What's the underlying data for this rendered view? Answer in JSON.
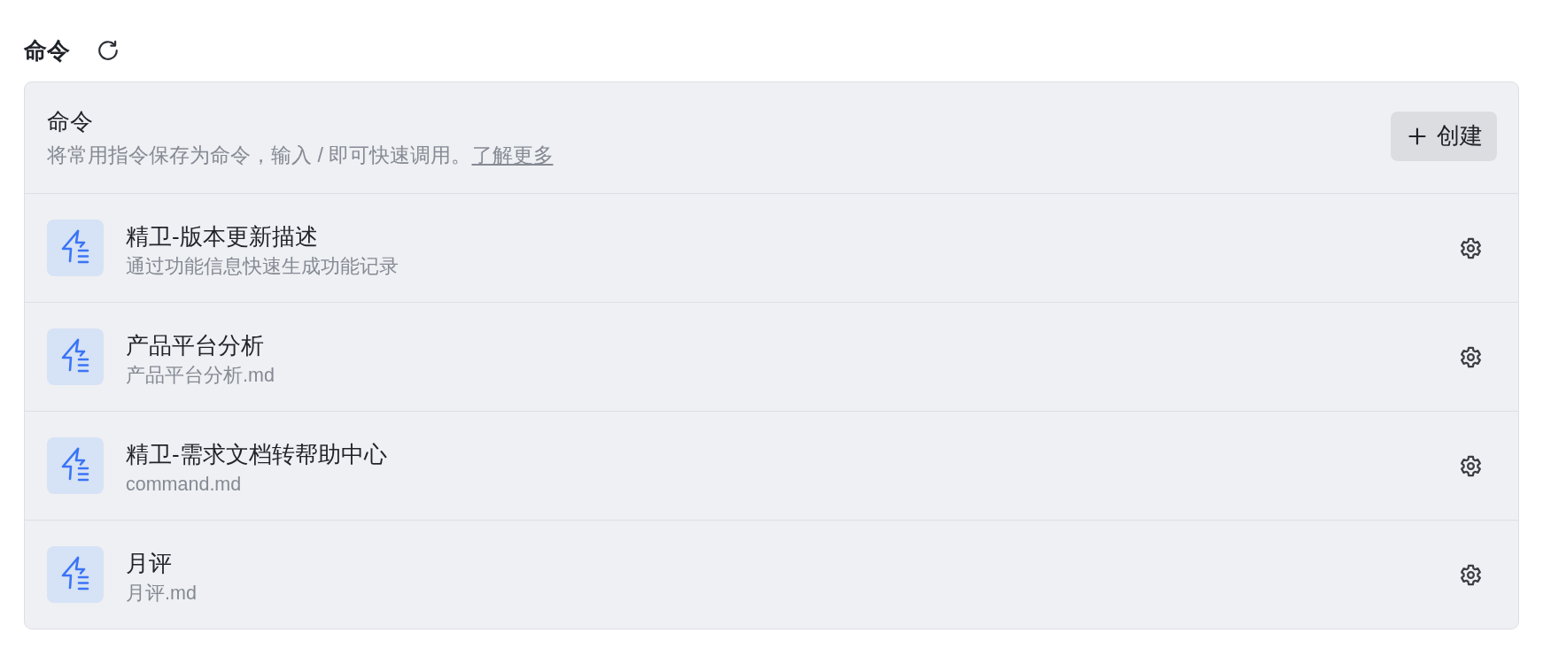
{
  "page": {
    "title": "命令"
  },
  "header": {
    "title": "命令",
    "description": "将常用指令保存为命令，输入 / 即可快速调用。",
    "link": "了解更多",
    "button": "创建"
  },
  "commands": [
    {
      "name": "精卫-版本更新描述",
      "description": "通过功能信息快速生成功能记录"
    },
    {
      "name": "产品平台分析",
      "description": "产品平台分析.md"
    },
    {
      "name": "精卫-需求文档转帮助中心",
      "description": "command.md"
    },
    {
      "name": "月评",
      "description": "月评.md"
    }
  ]
}
